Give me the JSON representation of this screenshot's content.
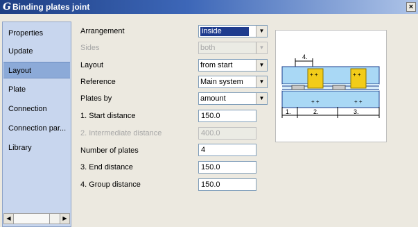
{
  "window": {
    "logo_glyph": "G",
    "title": "Binding plates joint",
    "close_glyph": "×"
  },
  "sidebar": {
    "items": [
      {
        "label": "Properties",
        "active": false
      },
      {
        "label": "Update",
        "active": false
      },
      {
        "label": "Layout",
        "active": true
      },
      {
        "label": "Plate",
        "active": false
      },
      {
        "label": "Connection",
        "active": false
      },
      {
        "label": "Connection par...",
        "active": false
      },
      {
        "label": "Library",
        "active": false
      }
    ],
    "scroll_left": "◀",
    "scroll_right": "▶"
  },
  "form": {
    "arrangement": {
      "label": "Arrangement",
      "value": "inside"
    },
    "sides": {
      "label": "Sides",
      "value": "both"
    },
    "layout": {
      "label": "Layout",
      "value": "from start"
    },
    "reference": {
      "label": "Reference",
      "value": "Main system"
    },
    "plates_by": {
      "label": "Plates by",
      "value": "amount"
    },
    "start_distance": {
      "label": "1. Start distance",
      "value": "150.0"
    },
    "intermediate_distance": {
      "label": "2. Intermediate distance",
      "value": "400.0"
    },
    "number_of_plates": {
      "label": "Number of plates",
      "value": "4"
    },
    "end_distance": {
      "label": "3. End distance",
      "value": "150.0"
    },
    "group_distance": {
      "label": "4. Group distance",
      "value": "150.0"
    },
    "dropdown_glyph": "▼"
  },
  "preview": {
    "dim_labels": [
      "4.",
      "1.",
      "2.",
      "3."
    ],
    "plate_marks": "+ +",
    "colors": {
      "beam": "#a9d8f5",
      "plate": "#f2cc1a",
      "line": "#1a3c8c"
    }
  }
}
